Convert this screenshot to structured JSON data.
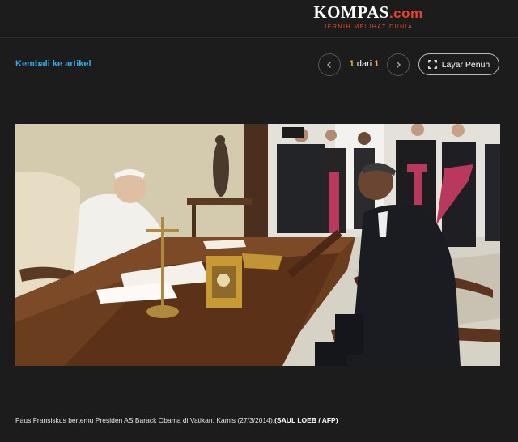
{
  "header": {
    "logo_text": "KOMPAS",
    "logo_suffix": ".com",
    "tagline": "JERNIH MELIHAT DUNIA"
  },
  "nav": {
    "back_label": "Kembali ke artikel",
    "current": "1",
    "of_label": "dari",
    "total": "1",
    "fullscreen_label": "Layar Penuh"
  },
  "photo": {
    "caption": "Paus Fransiskus bertemu Presiden AS Barack Obama di Vatikan, Kamis (27/3/2014).",
    "credit": "(SAUL LOEB / AFP)"
  },
  "colors": {
    "background": "#1c1c1c",
    "link": "#35a6e8",
    "brand_red": "#e8432d",
    "counter_accent": "#e8b630"
  }
}
